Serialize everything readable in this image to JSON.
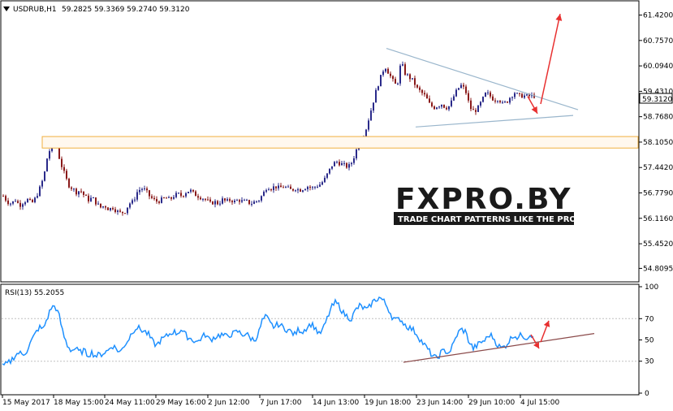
{
  "chart_data": [
    {
      "type": "candlestick",
      "symbol_label": "USDRUB,H1",
      "ohlc_label": "59.2825 59.3369 59.2740 59.3120",
      "current_price": 59.312,
      "current_price_label": "59.3120",
      "ylim": [
        54.5,
        61.75
      ],
      "y_ticks": [
        "61.4200",
        "60.7570",
        "60.0940",
        "59.4310",
        "58.7680",
        "58.1050",
        "57.4420",
        "56.7790",
        "56.1160",
        "55.4520",
        "54.8095"
      ],
      "x_ticks": [
        "15 May 2017",
        "18 May 15:00",
        "24 May 11:00",
        "29 May 16:00",
        "2 Jun 12:00",
        "7 Jun 17:00",
        "14 Jun 13:00",
        "19 Jun 18:00",
        "23 Jun 14:00",
        "29 Jun 10:00",
        "4 Jul 15:00"
      ],
      "approx_closes": [
        [
          0,
          56.7
        ],
        [
          5,
          56.55
        ],
        [
          10,
          56.5
        ],
        [
          15,
          56.6
        ],
        [
          20,
          56.45
        ],
        [
          25,
          56.55
        ],
        [
          30,
          56.6
        ],
        [
          35,
          56.5
        ],
        [
          40,
          56.65
        ],
        [
          45,
          56.9
        ],
        [
          50,
          57.2
        ],
        [
          55,
          57.8
        ],
        [
          60,
          58.0
        ],
        [
          65,
          58.1
        ],
        [
          70,
          57.6
        ],
        [
          75,
          57.3
        ],
        [
          80,
          57.0
        ],
        [
          85,
          56.9
        ],
        [
          90,
          56.8
        ],
        [
          95,
          56.85
        ],
        [
          100,
          56.7
        ],
        [
          105,
          56.6
        ],
        [
          110,
          56.65
        ],
        [
          115,
          56.5
        ],
        [
          120,
          56.4
        ],
        [
          125,
          56.45
        ],
        [
          130,
          56.35
        ],
        [
          135,
          56.4
        ],
        [
          140,
          56.3
        ],
        [
          145,
          56.25
        ],
        [
          150,
          56.3
        ],
        [
          155,
          56.5
        ],
        [
          160,
          56.55
        ],
        [
          165,
          56.8
        ],
        [
          170,
          56.9
        ],
        [
          175,
          56.85
        ],
        [
          180,
          56.7
        ],
        [
          185,
          56.6
        ],
        [
          190,
          56.55
        ],
        [
          195,
          56.6
        ],
        [
          200,
          56.65
        ],
        [
          205,
          56.6
        ],
        [
          210,
          56.7
        ],
        [
          215,
          56.75
        ],
        [
          220,
          56.7
        ],
        [
          225,
          56.8
        ],
        [
          230,
          56.85
        ],
        [
          235,
          56.75
        ],
        [
          240,
          56.7
        ],
        [
          245,
          56.65
        ],
        [
          250,
          56.6
        ],
        [
          255,
          56.5
        ],
        [
          260,
          56.55
        ],
        [
          265,
          56.5
        ],
        [
          270,
          56.6
        ],
        [
          275,
          56.55
        ],
        [
          280,
          56.6
        ],
        [
          285,
          56.55
        ],
        [
          290,
          56.6
        ],
        [
          295,
          56.55
        ],
        [
          300,
          56.55
        ],
        [
          305,
          56.5
        ],
        [
          310,
          56.55
        ],
        [
          315,
          56.6
        ],
        [
          320,
          56.75
        ],
        [
          325,
          56.95
        ],
        [
          330,
          56.9
        ],
        [
          335,
          56.95
        ],
        [
          340,
          56.9
        ],
        [
          345,
          56.95
        ],
        [
          350,
          56.9
        ],
        [
          355,
          56.85
        ],
        [
          360,
          56.9
        ],
        [
          365,
          56.85
        ],
        [
          370,
          56.9
        ],
        [
          375,
          56.95
        ],
        [
          380,
          56.9
        ],
        [
          385,
          56.95
        ],
        [
          390,
          57.0
        ],
        [
          395,
          57.1
        ],
        [
          400,
          57.3
        ],
        [
          405,
          57.5
        ],
        [
          410,
          57.6
        ],
        [
          415,
          57.55
        ],
        [
          420,
          57.5
        ],
        [
          425,
          57.45
        ],
        [
          430,
          57.6
        ],
        [
          435,
          57.9
        ],
        [
          440,
          58.1
        ],
        [
          445,
          58.3
        ],
        [
          450,
          58.7
        ],
        [
          455,
          59.1
        ],
        [
          460,
          59.5
        ],
        [
          465,
          59.8
        ],
        [
          470,
          60.1
        ],
        [
          475,
          59.9
        ],
        [
          480,
          59.7
        ],
        [
          485,
          59.55
        ],
        [
          490,
          60.2
        ],
        [
          495,
          59.9
        ],
        [
          500,
          59.8
        ],
        [
          505,
          59.7
        ],
        [
          510,
          59.5
        ],
        [
          515,
          59.4
        ],
        [
          520,
          59.3
        ],
        [
          525,
          59.1
        ],
        [
          530,
          59.0
        ],
        [
          535,
          59.05
        ],
        [
          540,
          59.1
        ],
        [
          545,
          59.0
        ],
        [
          550,
          59.05
        ],
        [
          555,
          59.3
        ],
        [
          560,
          59.5
        ],
        [
          565,
          59.6
        ],
        [
          570,
          59.4
        ],
        [
          575,
          59.0
        ],
        [
          580,
          58.9
        ],
        [
          585,
          59.0
        ],
        [
          590,
          59.2
        ],
        [
          595,
          59.4
        ],
        [
          600,
          59.3
        ],
        [
          605,
          59.2
        ],
        [
          610,
          59.25
        ],
        [
          615,
          59.1
        ],
        [
          620,
          59.15
        ],
        [
          625,
          59.3
        ],
        [
          630,
          59.4
        ],
        [
          635,
          59.3
        ],
        [
          640,
          59.32
        ],
        [
          645,
          59.3
        ],
        [
          650,
          59.31
        ]
      ]
    },
    {
      "type": "line",
      "label": "RSI(13) 55.2055",
      "ylim": [
        0,
        100
      ],
      "y_ticks": [
        "100",
        "70",
        "50",
        "30",
        "0"
      ],
      "approx_values": [
        [
          0,
          25
        ],
        [
          5,
          27
        ],
        [
          10,
          30
        ],
        [
          15,
          35
        ],
        [
          20,
          38
        ],
        [
          25,
          36
        ],
        [
          30,
          40
        ],
        [
          35,
          48
        ],
        [
          40,
          55
        ],
        [
          45,
          62
        ],
        [
          50,
          60
        ],
        [
          55,
          70
        ],
        [
          60,
          80
        ],
        [
          65,
          82
        ],
        [
          70,
          72
        ],
        [
          75,
          55
        ],
        [
          80,
          45
        ],
        [
          85,
          40
        ],
        [
          90,
          42
        ],
        [
          95,
          38
        ],
        [
          100,
          40
        ],
        [
          105,
          36
        ],
        [
          110,
          38
        ],
        [
          115,
          35
        ],
        [
          120,
          36
        ],
        [
          125,
          38
        ],
        [
          130,
          40
        ],
        [
          135,
          45
        ],
        [
          140,
          42
        ],
        [
          145,
          38
        ],
        [
          150,
          45
        ],
        [
          155,
          50
        ],
        [
          160,
          58
        ],
        [
          165,
          62
        ],
        [
          170,
          60
        ],
        [
          175,
          58
        ],
        [
          180,
          55
        ],
        [
          185,
          48
        ],
        [
          190,
          45
        ],
        [
          195,
          50
        ],
        [
          200,
          52
        ],
        [
          205,
          55
        ],
        [
          210,
          58
        ],
        [
          215,
          56
        ],
        [
          220,
          60
        ],
        [
          225,
          55
        ],
        [
          230,
          52
        ],
        [
          235,
          50
        ],
        [
          240,
          48
        ],
        [
          245,
          52
        ],
        [
          250,
          55
        ],
        [
          255,
          50
        ],
        [
          260,
          52
        ],
        [
          265,
          54
        ],
        [
          270,
          55
        ],
        [
          275,
          53
        ],
        [
          280,
          55
        ],
        [
          285,
          56
        ],
        [
          290,
          58
        ],
        [
          295,
          55
        ],
        [
          300,
          56
        ],
        [
          305,
          52
        ],
        [
          310,
          50
        ],
        [
          315,
          55
        ],
        [
          320,
          68
        ],
        [
          325,
          72
        ],
        [
          330,
          65
        ],
        [
          335,
          62
        ],
        [
          340,
          65
        ],
        [
          345,
          62
        ],
        [
          350,
          60
        ],
        [
          355,
          58
        ],
        [
          360,
          55
        ],
        [
          365,
          60
        ],
        [
          370,
          58
        ],
        [
          375,
          62
        ],
        [
          380,
          65
        ],
        [
          385,
          62
        ],
        [
          390,
          55
        ],
        [
          395,
          60
        ],
        [
          400,
          70
        ],
        [
          405,
          80
        ],
        [
          410,
          85
        ],
        [
          415,
          82
        ],
        [
          420,
          75
        ],
        [
          425,
          72
        ],
        [
          430,
          70
        ],
        [
          435,
          78
        ],
        [
          440,
          82
        ],
        [
          445,
          80
        ],
        [
          450,
          78
        ],
        [
          455,
          85
        ],
        [
          460,
          88
        ],
        [
          465,
          90
        ],
        [
          470,
          86
        ],
        [
          475,
          80
        ],
        [
          480,
          72
        ],
        [
          485,
          68
        ],
        [
          490,
          70
        ],
        [
          495,
          65
        ],
        [
          500,
          62
        ],
        [
          505,
          60
        ],
        [
          510,
          56
        ],
        [
          515,
          50
        ],
        [
          520,
          45
        ],
        [
          525,
          40
        ],
        [
          530,
          35
        ],
        [
          535,
          32
        ],
        [
          540,
          38
        ],
        [
          545,
          40
        ],
        [
          550,
          38
        ],
        [
          555,
          45
        ],
        [
          560,
          55
        ],
        [
          565,
          60
        ],
        [
          570,
          58
        ],
        [
          575,
          48
        ],
        [
          580,
          42
        ],
        [
          585,
          45
        ],
        [
          590,
          48
        ],
        [
          595,
          50
        ],
        [
          600,
          55
        ],
        [
          605,
          52
        ],
        [
          610,
          45
        ],
        [
          615,
          42
        ],
        [
          620,
          45
        ],
        [
          625,
          50
        ],
        [
          630,
          55
        ],
        [
          635,
          52
        ],
        [
          640,
          55
        ],
        [
          645,
          52
        ],
        [
          650,
          55
        ]
      ]
    }
  ],
  "watermark": {
    "brand": "FXPRO.BY",
    "tagline": "TRADE CHART PATTERNS LIKE THE PROS"
  }
}
